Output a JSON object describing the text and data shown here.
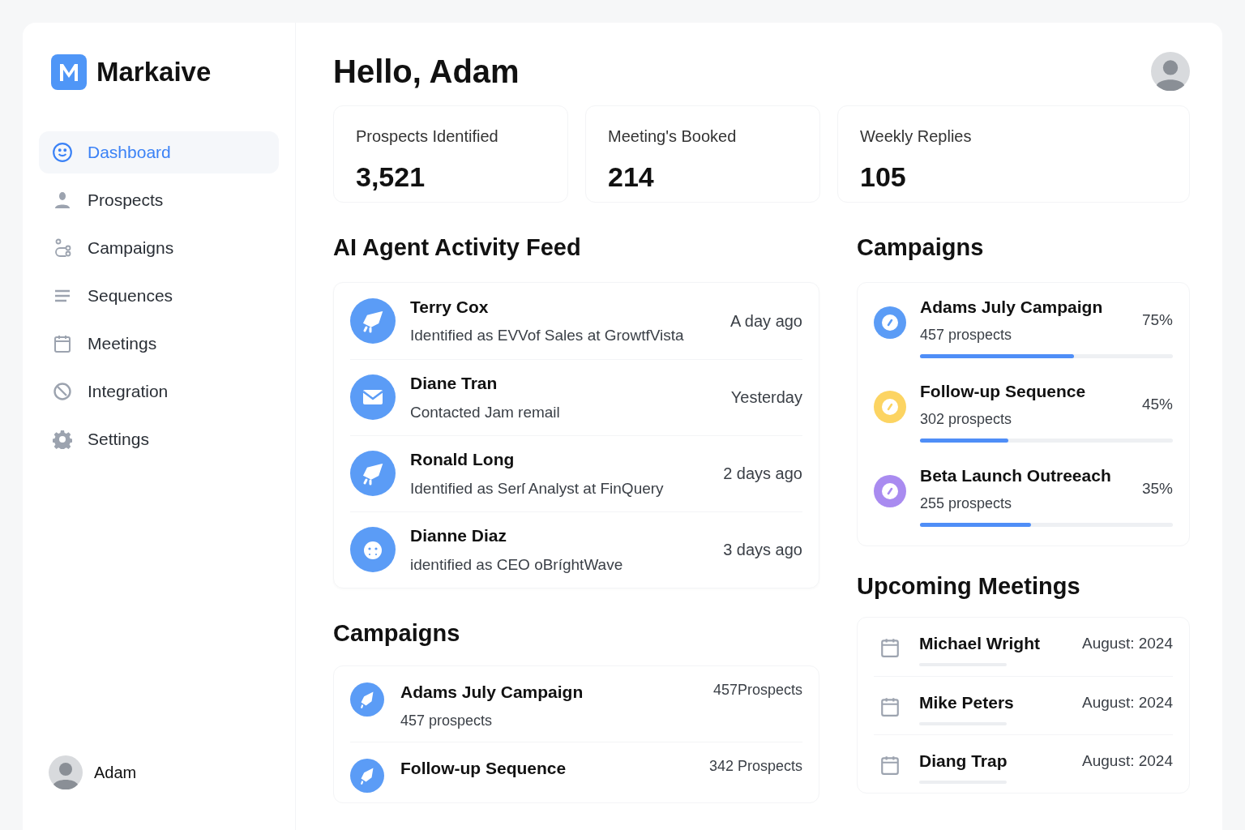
{
  "brand": {
    "name": "Markaive"
  },
  "sidebar": {
    "items": [
      {
        "label": "Dashboard",
        "selected": true
      },
      {
        "label": "Prospects",
        "selected": false
      },
      {
        "label": "Campaigns",
        "selected": false
      },
      {
        "label": "Sequences",
        "selected": false
      },
      {
        "label": "Meetings",
        "selected": false
      },
      {
        "label": "Integration",
        "selected": false
      },
      {
        "label": "Settings",
        "selected": false
      }
    ]
  },
  "user": {
    "name": "Adam"
  },
  "header": {
    "greeting": "Hello, Adam"
  },
  "stats": [
    {
      "label": "Prospects Identified",
      "value": "3,521"
    },
    {
      "label": "Meeting's Booked",
      "value": "214"
    },
    {
      "label": "Weekly Replies",
      "value": "105"
    }
  ],
  "activity_feed": {
    "title": "AI Agent Activity Feed",
    "items": [
      {
        "kind": "rocket",
        "name": "Terry Cox",
        "detail": "Identified as EVVof Sales at GrowtfVista",
        "time": "A day ago"
      },
      {
        "kind": "mail",
        "name": "Diane Tran",
        "detail": "Contacted Jam remail",
        "time": "Yesterday"
      },
      {
        "kind": "rocket",
        "name": "Ronald Long",
        "detail": "Identified as Serſ Analyst at FinQuery",
        "time": "2 days ago"
      },
      {
        "kind": "face",
        "name": "Dianne Diaz",
        "detail": "identified as CEO oBríghtWave",
        "time": "3 days ago"
      }
    ]
  },
  "campaigns_progress": {
    "title": "Campaigns",
    "items": [
      {
        "name": "Adams July Campaign",
        "prospects": "457 prospects",
        "percent": "75%",
        "level": 0.61,
        "color": "#5b9cf6"
      },
      {
        "name": "Follow-up Sequence",
        "prospects": "302 prospects",
        "percent": "45%",
        "level": 0.35,
        "color": "#fcd462"
      },
      {
        "name": "Beta Launch Outreeach",
        "prospects": "255 prospects",
        "percent": "35%",
        "level": 0.44,
        "color": "#a98bf0"
      }
    ]
  },
  "campaigns_list": {
    "title": "Campaigns",
    "items": [
      {
        "name": "Adams July Campaign",
        "prospects": "457 prospects",
        "count": "457Prospects"
      },
      {
        "name": "Follow-up Sequence",
        "count": "342 Prospects"
      }
    ]
  },
  "meetings": {
    "title": "Upcoming Meetings",
    "items": [
      {
        "name": "Michael Wright",
        "date": "August: 2024"
      },
      {
        "name": "Mike Peters",
        "date": "August: 2024"
      },
      {
        "name": "Diang Trap",
        "date": "August: 2024"
      }
    ]
  }
}
